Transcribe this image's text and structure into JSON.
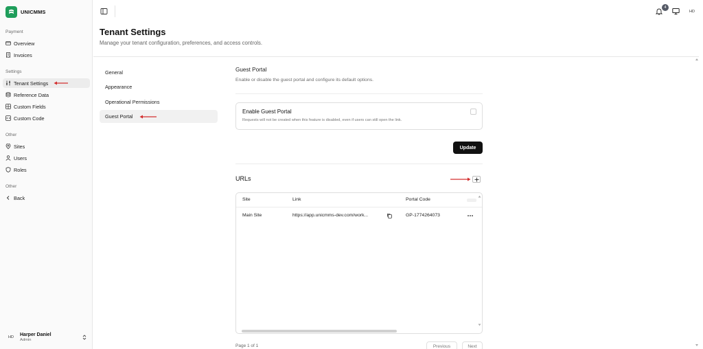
{
  "brand": {
    "name": "UNICMMS"
  },
  "sidebar": {
    "groups": [
      {
        "label": "Payment",
        "items": [
          {
            "label": "Overview",
            "icon": "wallet-icon"
          },
          {
            "label": "Invoices",
            "icon": "receipt-icon"
          }
        ]
      },
      {
        "label": "Settings",
        "items": [
          {
            "label": "Tenant Settings",
            "icon": "sliders-icon",
            "active": true
          },
          {
            "label": "Reference Data",
            "icon": "database-icon"
          },
          {
            "label": "Custom Fields",
            "icon": "grid-icon"
          },
          {
            "label": "Custom Code",
            "icon": "code-icon"
          }
        ]
      },
      {
        "label": "Other",
        "items": [
          {
            "label": "Sites",
            "icon": "map-pin-icon"
          },
          {
            "label": "Users",
            "icon": "user-icon"
          },
          {
            "label": "Roles",
            "icon": "shield-icon"
          }
        ]
      },
      {
        "label": "Other",
        "items": [
          {
            "label": "Back",
            "icon": "chevron-left-icon"
          }
        ]
      }
    ],
    "user": {
      "initials": "HD",
      "name": "Harper Daniel",
      "role": "Admin"
    }
  },
  "topbar": {
    "notification_count": "4",
    "avatar_initials": "HD"
  },
  "page": {
    "title": "Tenant Settings",
    "subtitle": "Manage your tenant configuration, preferences, and access controls."
  },
  "settings_nav": [
    {
      "label": "General"
    },
    {
      "label": "Appearance"
    },
    {
      "label": "Operational Permissions"
    },
    {
      "label": "Guest Portal",
      "active": true
    }
  ],
  "guest_portal": {
    "title": "Guest Portal",
    "description": "Enable or disable the guest portal and configure its default options.",
    "toggle_title": "Enable Guest Portal",
    "toggle_description": "Requests will not be created when this feature is disabled, even if users can still open the link.",
    "enabled": false,
    "update_label": "Update"
  },
  "urls": {
    "title": "URLs",
    "add_label": "+",
    "columns": [
      "Site",
      "Link",
      "Portal Code"
    ],
    "rows": [
      {
        "site": "Main Site",
        "link": "https://app.unicmms-dev.com/work...",
        "code": "GP-1774264073"
      }
    ],
    "pagination": {
      "page_text": "Page 1 of 1",
      "previous": "Previous",
      "next": "Next"
    }
  },
  "colors": {
    "brand": "#1f9e5b",
    "primary_button": "#111111",
    "annotation_arrow": "#d32f2f"
  }
}
